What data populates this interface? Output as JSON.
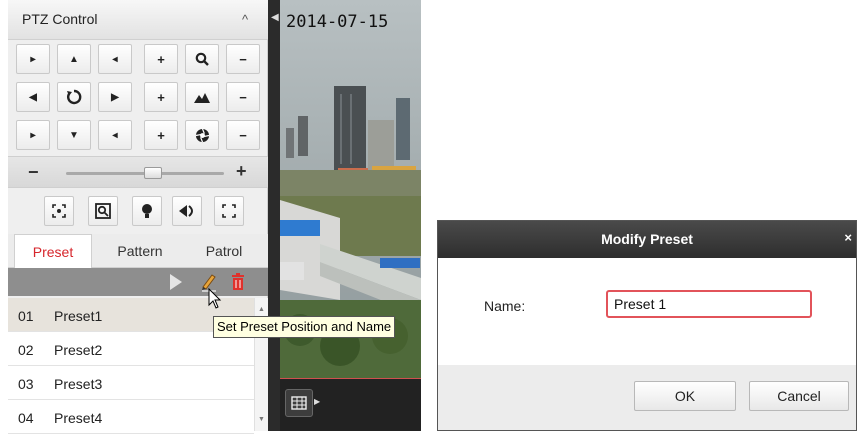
{
  "ptz": {
    "title": "PTZ Control",
    "collapse_glyph": "^",
    "speed_minus": "−",
    "speed_plus": "+",
    "speed_level": 0.55,
    "tabs": [
      {
        "label": "Preset",
        "active": true
      },
      {
        "label": "Pattern",
        "active": false
      },
      {
        "label": "Patrol",
        "active": false
      }
    ],
    "presets": [
      {
        "num": "01",
        "name": "Preset1",
        "selected": true
      },
      {
        "num": "02",
        "name": "Preset2",
        "selected": false
      },
      {
        "num": "03",
        "name": "Preset3",
        "selected": false
      },
      {
        "num": "04",
        "name": "Preset4",
        "selected": false
      }
    ],
    "tooltip": "Set Preset Position and Name",
    "icons": {
      "toolbar": [
        "play-icon",
        "edit-icon",
        "delete-icon"
      ],
      "function_row": [
        "auto-focus-icon",
        "3d-zoom-icon",
        "light-icon",
        "wiper-icon",
        "init-lens-icon"
      ]
    },
    "colors": {
      "active_tab": "#d6262c",
      "toolbar": "#8e8e8e",
      "delete": "#e0312c",
      "edit": "#e8a53a"
    }
  },
  "video": {
    "date": "2014-07-15"
  },
  "dialog": {
    "title": "Modify Preset",
    "close": "×",
    "name_label": "Name:",
    "name_value": "Preset 1",
    "ok": "OK",
    "cancel": "Cancel",
    "colors": {
      "input_border": "#e2535a",
      "title_bar": "#3a3a3a"
    }
  }
}
